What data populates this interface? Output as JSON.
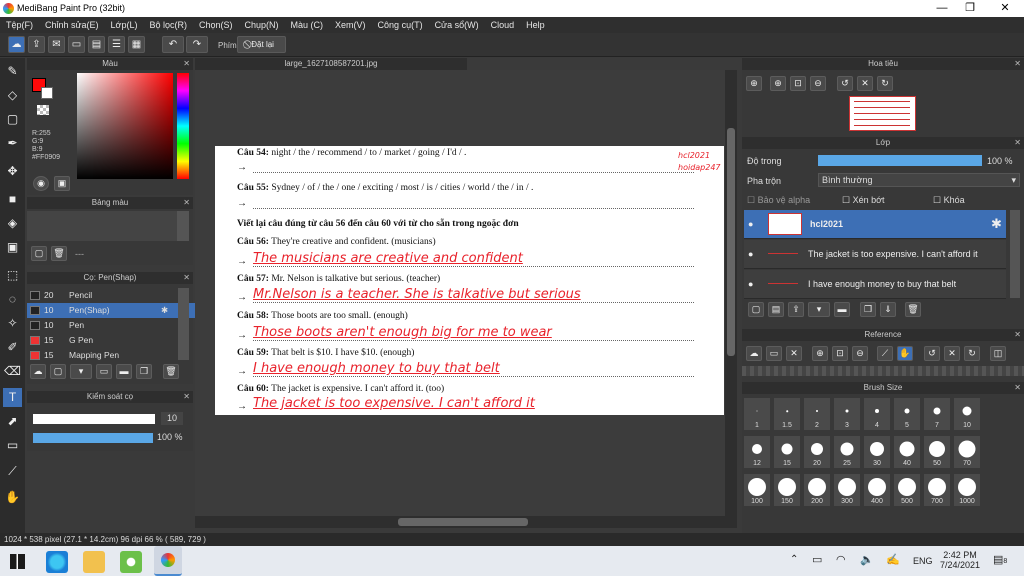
{
  "window": {
    "title": "MediBang Paint Pro (32bit)",
    "minimize": "—",
    "maximize": "❐",
    "close": "✕"
  },
  "menu": [
    "Tệp(F)",
    "Chỉnh sửa(E)",
    "Lớp(L)",
    "Bộ lọc(R)",
    "Chọn(S)",
    "Chụp(N)",
    "Màu (C)",
    "Xem(V)",
    "Công cụ(T)",
    "Cửa sổ(W)",
    "Cloud",
    "Help"
  ],
  "toolbar": {
    "key_label": "Phím",
    "reset_label": "Đặt lại"
  },
  "color_panel": {
    "title": "Màu",
    "r": "R:255",
    "g": "G:9",
    "b": "B:9",
    "hex": "#FF0909",
    "primary": "#FF0909"
  },
  "palette_panel": {
    "title": "Bảng màu",
    "dash": "---"
  },
  "brush_panel": {
    "title": "Cọ: Pen(Shap)",
    "items": [
      {
        "size": "20",
        "name": "Pencil",
        "color": "#222222"
      },
      {
        "size": "10",
        "name": "Pen(Shap)",
        "color": "#222222",
        "selected": true
      },
      {
        "size": "10",
        "name": "Pen",
        "color": "#222222"
      },
      {
        "size": "15",
        "name": "G Pen",
        "color": "#e33"
      },
      {
        "size": "15",
        "name": "Mapping Pen",
        "color": "#e33"
      }
    ]
  },
  "control_panel": {
    "title": "Kiểm soát cọ",
    "size": "10",
    "opacity": "100 %",
    "size_fill": 1.0,
    "opacity_fill": 1.0
  },
  "canvas": {
    "tab": "large_1627108587201.jpg"
  },
  "doc": {
    "q54": "Câu 54:",
    "q54t": "night / the / recommend / to / market / going / I'd / .",
    "q55": "Câu 55:",
    "q55t": "Sydney / of / the / one / exciting / most / is / cities / world / the  / in / .",
    "instr": "Viết lại câu đúng từ câu 56 đến câu 60 với từ cho sẵn trong ngoặc đơn",
    "q56": "Câu 56:",
    "q56t": "They're creative and confident. (musicians)",
    "a56": "The musicians are creative and confident",
    "q57": "Câu 57:",
    "q57t": "Mr. Nelson is talkative but serious. (teacher)",
    "a57": "Mr.Nelson is a teacher. She is talkative but serious",
    "q58": "Câu 58:",
    "q58t": "Those boots are too small. (enough)",
    "a58": "Those boots aren't enough big for me to wear",
    "q59": "Câu 59:",
    "q59t": "That belt is $10. I have $10. (enough)",
    "a59": "I have enough money to buy that belt",
    "q60": "Câu 60:",
    "q60t": "The jacket is expensive. I can't afford it. (too)",
    "a60": "The jacket is too expensive. I can't afford it",
    "arrow": "→",
    "wm1": "hcl2021",
    "wm2": "hoidap247"
  },
  "navigator": {
    "title": "Hoa tiêu"
  },
  "layer_panel": {
    "title": "Lớp",
    "opacity_label": "Độ trong",
    "opacity_value": "100 %",
    "blend_label": "Pha trộn",
    "blend_value": "Bình thường",
    "protect_alpha": "Bảo vệ alpha",
    "clip": "Xén bớt",
    "lock": "Khóa",
    "layers": [
      {
        "name": "hcl2021",
        "selected": true
      },
      {
        "name": "The jacket is too expensive. I can't afford it"
      },
      {
        "name": "I have enough money to buy that belt"
      }
    ]
  },
  "reference_panel": {
    "title": "Reference"
  },
  "brush_size_panel": {
    "title": "Brush Size",
    "sizes": [
      "1",
      "1.5",
      "2",
      "3",
      "4",
      "5",
      "7",
      "10",
      "12",
      "15",
      "20",
      "25",
      "30",
      "40",
      "50",
      "70",
      "100",
      "150",
      "200",
      "300",
      "400",
      "500",
      "700",
      "1000"
    ]
  },
  "status": {
    "text": "1024 * 538 pixel   (27.1 * 14.2cm)   96 dpi   66 %   ( 589, 729 )"
  },
  "taskbar": {
    "lang": "ENG",
    "time": "2:42 PM",
    "date": "7/24/2021",
    "notif": "8"
  }
}
